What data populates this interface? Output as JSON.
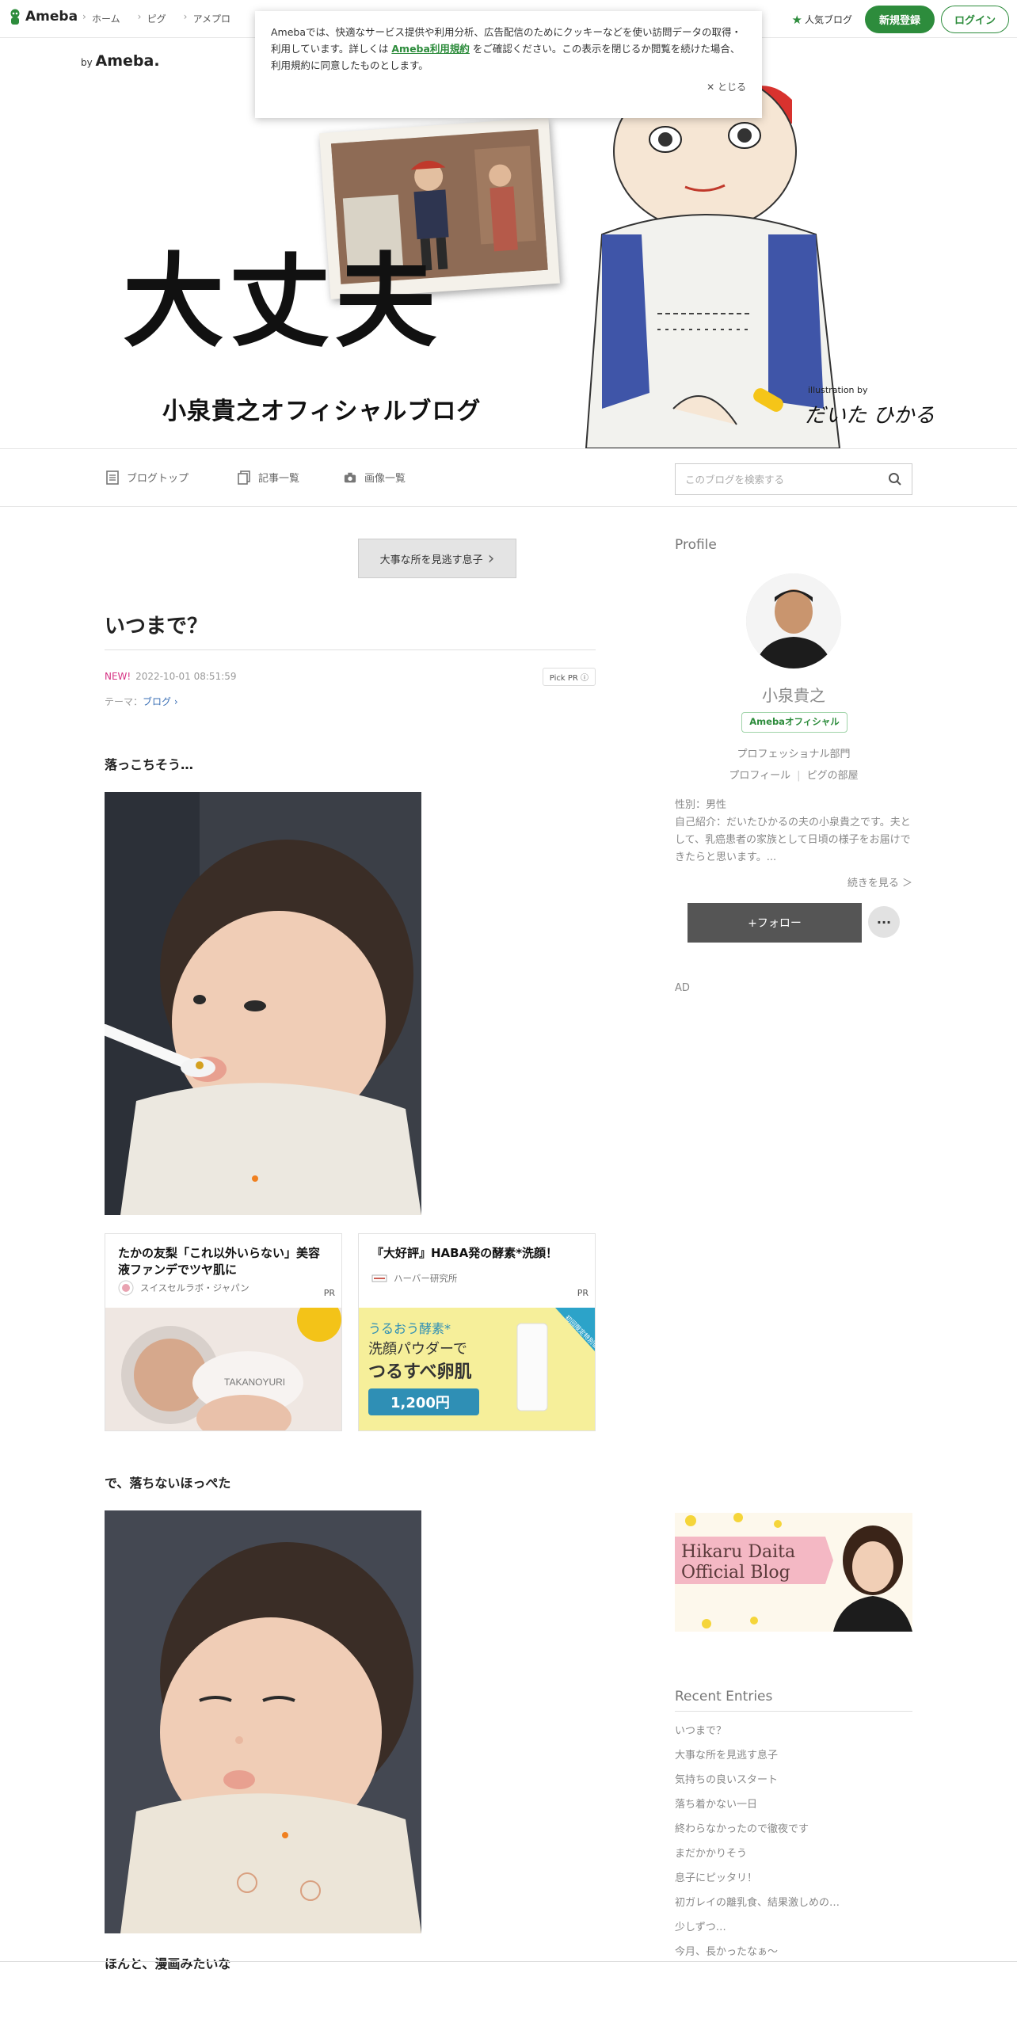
{
  "header": {
    "logo": "Ameba",
    "nav": [
      "ホーム",
      "ピグ",
      "アメプロ"
    ],
    "popular": "人気ブログ",
    "register": "新規登録",
    "login": "ログイン"
  },
  "cookie": {
    "text_before": "Amebaでは、快適なサービス提供や利用分析、広告配信のためにクッキーなどを使い訪問データの取得・利用しています。詳しくは",
    "link": "Ameba利用規約",
    "text_after": "をご確認ください。この表示を閉じるか閲覧を続けた場合、利用規約に同意したものとします。",
    "close": "✕ とじる"
  },
  "hero": {
    "by": "by",
    "brand": "Ameba.",
    "title": "大丈夫",
    "subtitle": "小泉貴之オフィシャルブログ",
    "illustration_by": "illustration by",
    "signature": "だいた ひかる"
  },
  "blognav": {
    "top": "ブログトップ",
    "entries": "記事一覧",
    "images": "画像一覧",
    "search_placeholder": "このブログを検索する"
  },
  "entry": {
    "prev": "大事な所を見逃す息子",
    "title": "いつまで？",
    "new": "NEW!",
    "date": "2022-10-01 08:51:59",
    "pickpr": "Pick PR ⓘ",
    "theme_label": "テーマ：",
    "theme": "ブログ ›",
    "p1": "落っこちそう…",
    "p2": "で、落ちないほっぺた",
    "p3": "ほんと、漫画みたいな"
  },
  "ads": [
    {
      "title": "たかの友梨「これ以外いらない」美容液ファンデでツヤ肌に",
      "source": "スイスセルラボ・ジャパン",
      "pr": "PR",
      "brand": "TAKANOYURI"
    },
    {
      "title": "『大好評』HABA発の酵素*洗顔！",
      "source": "ハーバー研究所",
      "pr": "PR",
      "line1": "うるおう酵素*",
      "line2": "洗顔パウダーで",
      "line3": "つるすべ卵肌",
      "price": "1,200円",
      "ribbon": "初回限定特別価格!"
    }
  ],
  "sidebar": {
    "profile_heading": "Profile",
    "name": "小泉貴之",
    "badge": "Amebaオフィシャル",
    "dept": "プロフェッショナル部門",
    "link_profile": "プロフィール",
    "link_pig": "ピグの部屋",
    "gender": "性別：男性",
    "intro": "自己紹介：だいたひかるの夫の小泉貴之です。夫として、乳癌患者の家族として日頃の様子をお届けできたらと思います。...",
    "readmore": "続きを見る ＞",
    "follow": "+フォロー",
    "more": "···",
    "ad": "AD",
    "banner_line1": "Hikaru Daita",
    "banner_line2": "Official Blog",
    "recent_heading": "Recent Entries",
    "recent": [
      "いつまで？",
      "大事な所を見逃す息子",
      "気持ちの良いスタート",
      "落ち着かない一日",
      "終わらなかったので徹夜です",
      "まだかかりそう",
      "息子にピッタリ！",
      "初ガレイの離乳食、結果激しめの…",
      "少しずつ…",
      "今月、長かったなぁ〜"
    ]
  }
}
